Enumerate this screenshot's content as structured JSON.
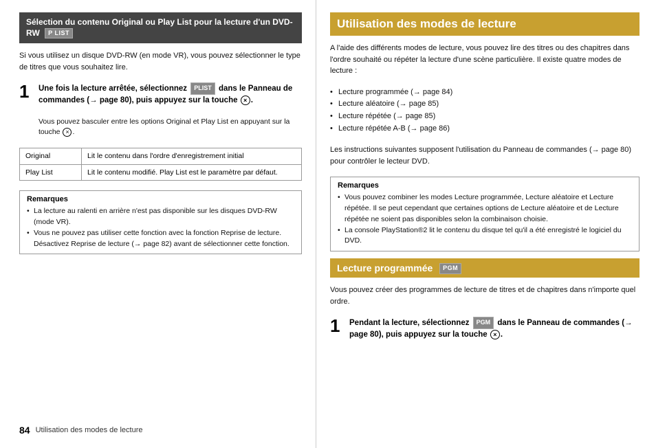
{
  "left": {
    "section_title": "Sélection du contenu Original ou Play List pour la lecture d'un DVD-RW",
    "section_badge": "P LIST",
    "intro_text": "Si vous utilisez un disque DVD-RW (en mode VR), vous pouvez sélectionner le type de titres que vous souhaitez lire.",
    "step1": {
      "number": "1",
      "text_parts": [
        "Une fois la lecture arrêtée, sélectionnez ",
        "PLIST",
        " dans le Panneau de commandes (→ page 80), puis appuyez sur la touche "
      ],
      "sub_text": "Vous pouvez basculer entre les options Original et Play List en appuyant sur la touche "
    },
    "table": {
      "rows": [
        {
          "label": "Original",
          "description": "Lit le contenu dans l'ordre d'enregistrement initial"
        },
        {
          "label": "Play List",
          "description": "Lit le contenu modifié. Play List est le paramètre par défaut."
        }
      ]
    },
    "remarks": {
      "title": "Remarques",
      "items": [
        "La lecture au ralenti en arrière n'est pas disponible sur les disques DVD-RW (mode VR).",
        "Vous ne pouvez pas utiliser cette fonction avec la fonction Reprise de lecture. Désactivez Reprise de lecture (→ page 82) avant de sélectionner cette fonction."
      ]
    },
    "footer": {
      "page_number": "84",
      "page_label": "Utilisation des modes de lecture"
    }
  },
  "right": {
    "main_title": "Utilisation des modes de lecture",
    "intro_text": "A l'aide des différents modes de lecture, vous pouvez lire des titres ou des chapitres dans l'ordre souhaité ou répéter la lecture d'une scène particulière. Il existe quatre modes de lecture :",
    "bullet_items": [
      "Lecture programmée (→ page 84)",
      "Lecture aléatoire (→ page 85)",
      "Lecture répétée (→ page 85)",
      "Lecture répétée A-B (→ page 86)"
    ],
    "panel_text": "Les instructions suivantes supposent l'utilisation du Panneau de commandes (→ page 80) pour contrôler le lecteur DVD.",
    "remarks": {
      "title": "Remarques",
      "items": [
        "Vous pouvez combiner les modes Lecture programmée, Lecture aléatoire et Lecture répétée. Il se peut cependant que certaines options de Lecture aléatoire et de Lecture répétée ne soient pas disponibles selon la combinaison choisie.",
        "La console PlayStation®2 lit le contenu du disque tel qu'il a été enregistré le logiciel du DVD."
      ]
    },
    "sub_section": {
      "title": "Lecture programmée",
      "badge": "PGM",
      "intro": "Vous pouvez créer des programmes de lecture de titres et de chapitres dans n'importe quel ordre.",
      "step1": {
        "number": "1",
        "text": "Pendant la lecture, sélectionnez ",
        "badge": "PGM",
        "text2": " dans le Panneau de commandes (→ page 80), puis appuyez sur la touche "
      }
    }
  }
}
